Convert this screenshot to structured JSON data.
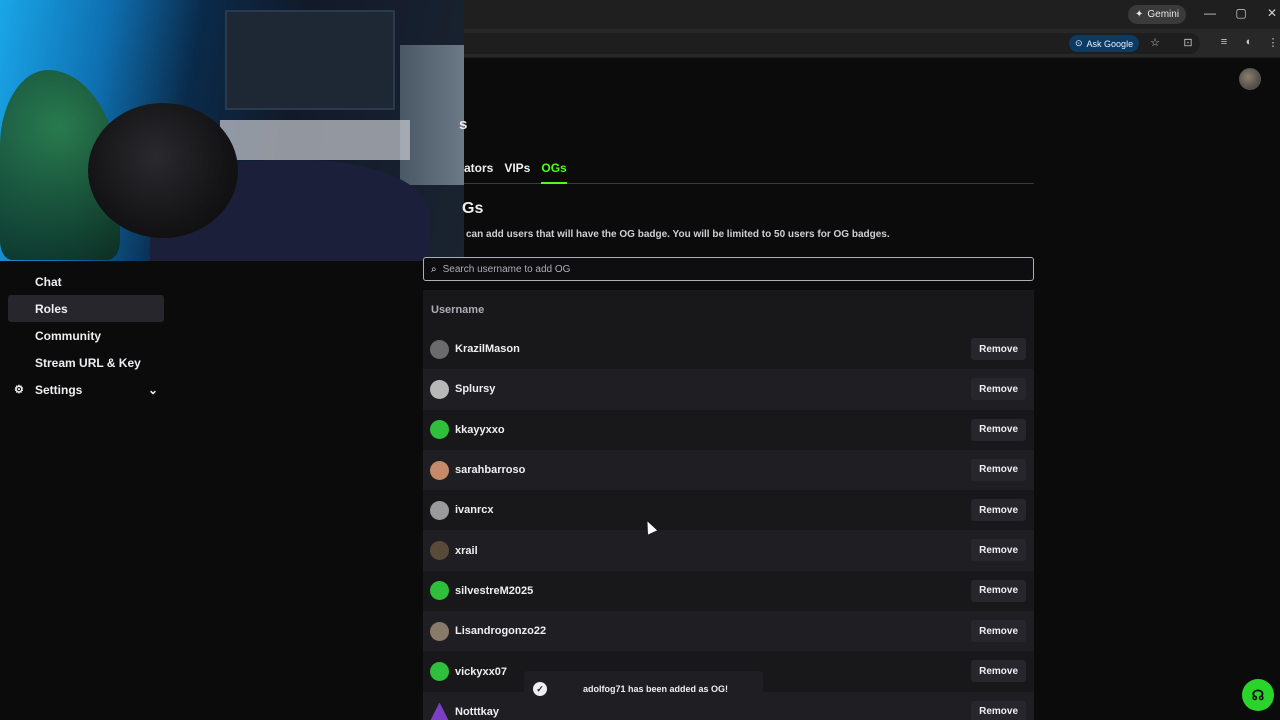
{
  "browser": {
    "gemini_label": "Gemini",
    "ask_google_label": "Ask Google",
    "controls": {
      "minimize": "—",
      "maximize": "▢",
      "close": "✕"
    }
  },
  "sidebar": {
    "items": [
      {
        "label": "Chat",
        "active": false
      },
      {
        "label": "Roles",
        "active": true
      },
      {
        "label": "Community",
        "active": false
      },
      {
        "label": "Stream URL & Key",
        "active": false
      },
      {
        "label": "Settings",
        "active": false,
        "icon": "gear-icon",
        "expandable": true
      }
    ]
  },
  "main": {
    "heading_fragment": "s",
    "tabs": [
      {
        "label": "ators",
        "active": false
      },
      {
        "label": "VIPs",
        "active": false
      },
      {
        "label": "OGs",
        "active": true
      }
    ],
    "section_title": "Gs",
    "section_desc": "can add users that will have the OG badge. You will be limited to 50 users for OG badges.",
    "search_placeholder": "Search username to add OG",
    "table": {
      "column_header": "Username",
      "remove_label": "Remove",
      "rows": [
        {
          "username": "KrazilMason",
          "avatar_color": "#6b6b6b"
        },
        {
          "username": "Splursy",
          "avatar_color": "#b8b8b8"
        },
        {
          "username": "kkayyxxo",
          "avatar_color": "#2fbf3a"
        },
        {
          "username": "sarahbarroso",
          "avatar_color": "#c48a6a"
        },
        {
          "username": "ivanrcx",
          "avatar_color": "#9a9a9a"
        },
        {
          "username": "xrail",
          "avatar_color": "#5a4a3a"
        },
        {
          "username": "silvestreM2025",
          "avatar_color": "#2fbf3a"
        },
        {
          "username": "Lisandrogonzo22",
          "avatar_color": "#8a7a6a"
        },
        {
          "username": "vickyxx07",
          "avatar_color": "#2fbf3a"
        },
        {
          "username": "Notttkay",
          "avatar_color": "#7b3fc4"
        }
      ]
    }
  },
  "toast": {
    "message": "adolfog71 has been added as OG!"
  },
  "colors": {
    "accent": "#53fc18",
    "background": "#0b0b0c",
    "panel": "#18181b"
  }
}
